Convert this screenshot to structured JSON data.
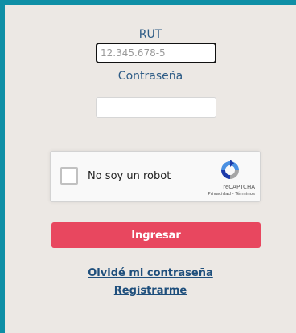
{
  "form": {
    "rut_label": "RUT",
    "rut_placeholder": "12.345.678-5",
    "rut_value": "",
    "password_label": "Contraseña",
    "password_placeholder": "",
    "password_value": ""
  },
  "captcha": {
    "label": "No soy un robot",
    "brand": "reCAPTCHA",
    "privacy_link": "Privacidad",
    "separator": " - ",
    "terms_link": "Términos",
    "logo_icon": "recaptcha-logo-icon",
    "checked": false
  },
  "actions": {
    "submit_label": "Ingresar",
    "forgot_password_label": "Olvidé mi contraseña",
    "register_label": "Registrarme"
  },
  "colors": {
    "frame": "#0f8fa6",
    "panel_bg": "#ece8e4",
    "label_text": "#2e5c86",
    "submit_bg": "#e8475f",
    "link_text": "#1f4f7c"
  }
}
